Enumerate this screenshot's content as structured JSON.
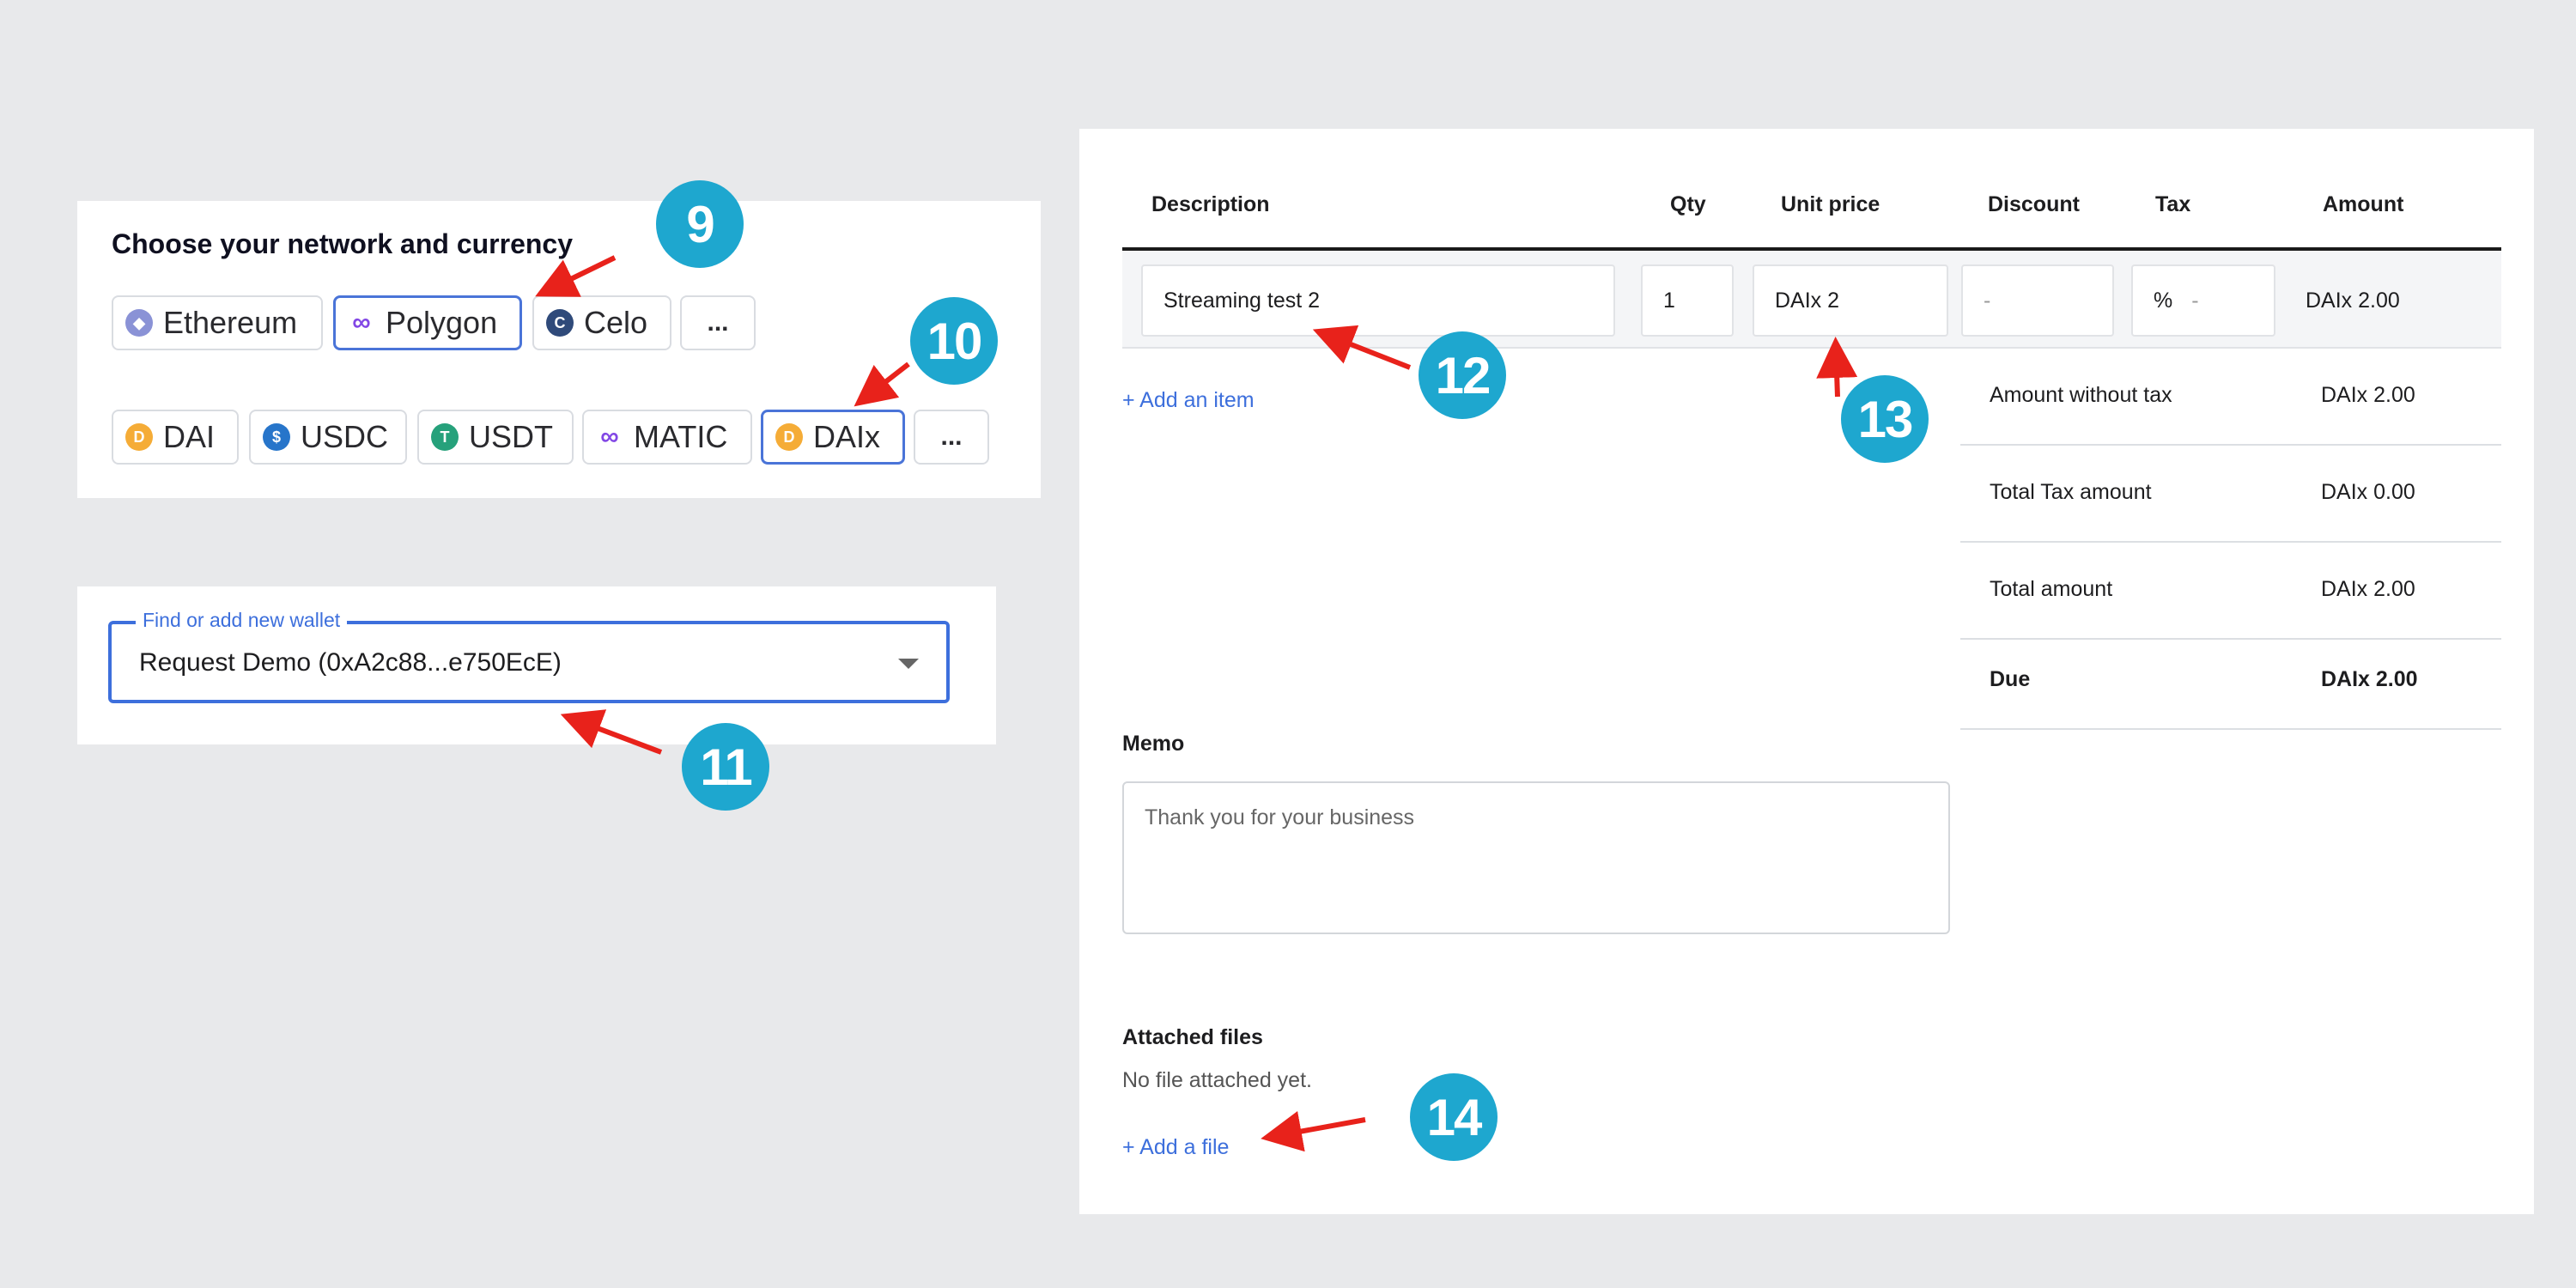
{
  "network_panel": {
    "title": "Choose your network and currency",
    "networks": [
      {
        "label": "Ethereum",
        "icon": "ethereum-icon",
        "icon_color": "#8a92d6",
        "glyph": "♦",
        "selected": false
      },
      {
        "label": "Polygon",
        "icon": "polygon-icon",
        "icon_color": "#8247e5",
        "glyph": "∞",
        "selected": true
      },
      {
        "label": "Celo",
        "icon": "celo-icon",
        "icon_color": "#2f4a7a",
        "glyph": "C",
        "selected": false
      }
    ],
    "currencies": [
      {
        "label": "DAI",
        "icon": "dai-icon",
        "icon_color": "#f5ac37",
        "glyph": "D",
        "selected": false
      },
      {
        "label": "USDC",
        "icon": "usdc-icon",
        "icon_color": "#2775ca",
        "glyph": "$",
        "selected": false
      },
      {
        "label": "USDT",
        "icon": "usdt-icon",
        "icon_color": "#26a17b",
        "glyph": "T",
        "selected": false
      },
      {
        "label": "MATIC",
        "icon": "matic-icon",
        "icon_color": "#8247e5",
        "glyph": "∞",
        "selected": false
      },
      {
        "label": "DAIx",
        "icon": "daix-icon",
        "icon_color": "#f5ac37",
        "glyph": "D",
        "selected": true
      }
    ],
    "more_label": "..."
  },
  "wallet": {
    "label": "Find or add new wallet",
    "value": "Request Demo (0xA2c88...e750EcE)"
  },
  "invoice": {
    "columns": {
      "description": "Description",
      "qty": "Qty",
      "unit_price": "Unit price",
      "discount": "Discount",
      "tax": "Tax",
      "amount": "Amount"
    },
    "item": {
      "description": "Streaming test 2",
      "qty": "1",
      "unit_price": "DAIx 2",
      "discount": "-",
      "tax_unit": "%",
      "tax": "-",
      "amount": "DAIx 2.00"
    },
    "add_item_label": "+ Add an item",
    "summary": [
      {
        "label": "Amount without tax",
        "value": "DAIx 2.00"
      },
      {
        "label": "Total Tax amount",
        "value": "DAIx 0.00"
      },
      {
        "label": "Total amount",
        "value": "DAIx 2.00"
      },
      {
        "label": "Due",
        "value": "DAIx 2.00"
      }
    ],
    "memo_title": "Memo",
    "memo_placeholder": "Thank you for your business",
    "attached_title": "Attached files",
    "no_file_text": "No file attached yet.",
    "add_file_label": "+ Add a file"
  },
  "callouts": [
    "9",
    "10",
    "11",
    "12",
    "13",
    "14"
  ],
  "colors": {
    "background": "#e8e9eb",
    "accent": "#3d6fdc",
    "badge": "#1ea7cf",
    "arrow": "#e8221b"
  }
}
